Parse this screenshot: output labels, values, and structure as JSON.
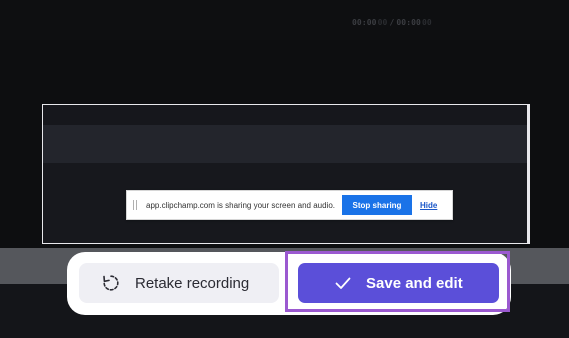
{
  "timecode": {
    "current": "00:00",
    "current_frac": "00",
    "separator": "/",
    "total": "00:00",
    "total_frac": "00"
  },
  "share_notice": {
    "message": "app.clipchamp.com is sharing your screen and audio.",
    "stop_label": "Stop sharing",
    "hide_label": "Hide"
  },
  "controls": {
    "retake_label": "Retake recording",
    "save_label": "Save and edit"
  },
  "colors": {
    "accent": "#5b4fd9",
    "highlight": "#9b59d0",
    "stop_button": "#1a73e8"
  },
  "icons": {
    "retake": "retake-icon",
    "save": "checkmark-icon",
    "grip": "drag-grip-icon"
  }
}
